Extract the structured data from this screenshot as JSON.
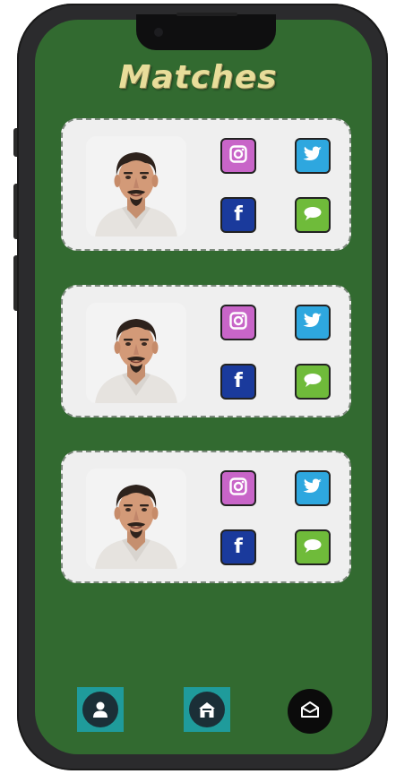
{
  "app": {
    "title": "Matches"
  },
  "colors": {
    "screen_bg": "#326a30",
    "card_bg": "#efefef",
    "title_color": "#e8dd9a",
    "instagram": "#c865c8",
    "twitter": "#2ea7df",
    "facebook": "#1a3a9c",
    "message": "#6fbb3a",
    "nav_accent": "#1f9b9b"
  },
  "matches": [
    {
      "photo_icon": "profile-photo",
      "socials": [
        {
          "name": "instagram",
          "icon": "instagram-icon"
        },
        {
          "name": "twitter",
          "icon": "twitter-icon"
        },
        {
          "name": "facebook",
          "icon": "facebook-icon",
          "glyph": "f"
        },
        {
          "name": "message",
          "icon": "message-icon"
        }
      ]
    },
    {
      "photo_icon": "profile-photo",
      "socials": [
        {
          "name": "instagram",
          "icon": "instagram-icon"
        },
        {
          "name": "twitter",
          "icon": "twitter-icon"
        },
        {
          "name": "facebook",
          "icon": "facebook-icon",
          "glyph": "f"
        },
        {
          "name": "message",
          "icon": "message-icon"
        }
      ]
    },
    {
      "photo_icon": "profile-photo",
      "socials": [
        {
          "name": "instagram",
          "icon": "instagram-icon"
        },
        {
          "name": "twitter",
          "icon": "twitter-icon"
        },
        {
          "name": "facebook",
          "icon": "facebook-icon",
          "glyph": "f"
        },
        {
          "name": "message",
          "icon": "message-icon"
        }
      ]
    }
  ],
  "nav": {
    "items": [
      {
        "name": "profile",
        "icon": "user-icon"
      },
      {
        "name": "home",
        "icon": "home-icon"
      },
      {
        "name": "inbox",
        "icon": "mail-icon"
      }
    ]
  }
}
